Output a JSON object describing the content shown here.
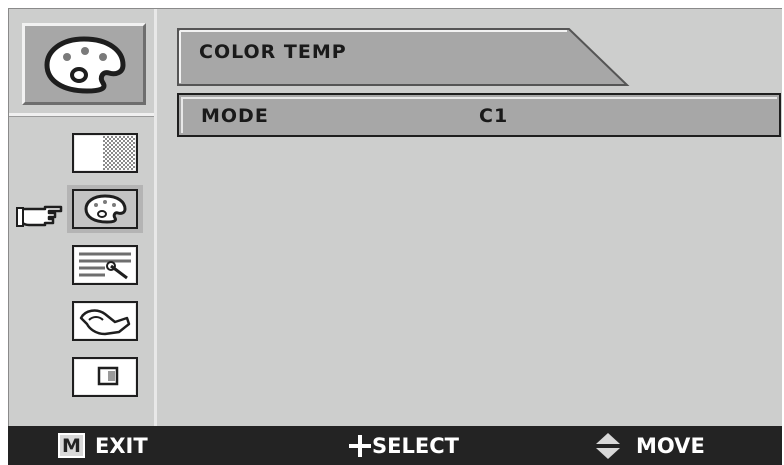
{
  "sidebar": {
    "current_icon": "palette-icon",
    "items": [
      {
        "icon": "picture-pattern-icon",
        "active": false
      },
      {
        "icon": "palette-icon",
        "active": true
      },
      {
        "icon": "settings-tools-icon",
        "active": false
      },
      {
        "icon": "hand-icon",
        "active": false
      },
      {
        "icon": "pip-window-icon",
        "active": false
      }
    ],
    "pointer_icon": "pointing-hand-icon"
  },
  "header": {
    "title": "COLOR TEMP"
  },
  "mode": {
    "label": "MODE",
    "value": "C1"
  },
  "footer": {
    "exit_key": "M",
    "exit_label": "EXIT",
    "select_label": "SELECT",
    "move_label": "MOVE"
  },
  "colors": {
    "panel_bg": "#cdcecd",
    "highlight": "#a7a7a7",
    "footer_bg": "#232323"
  }
}
